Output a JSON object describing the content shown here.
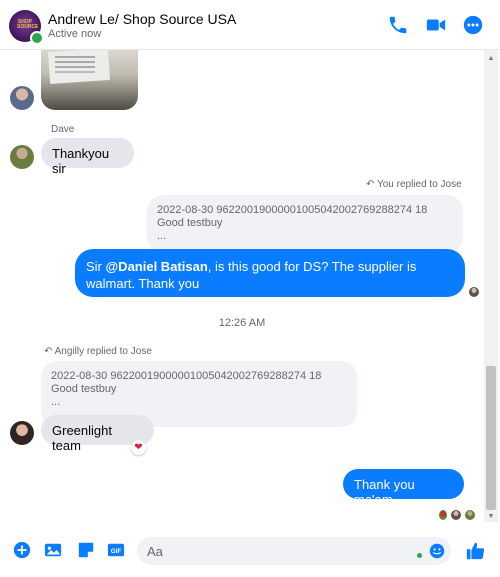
{
  "header": {
    "title": "Andrew Le/ Shop Source USA",
    "status": "Active now",
    "avatar_text": "SHOP SOURCE"
  },
  "messages": {
    "dave_name": "Dave",
    "dave_text": "Thankyou sir",
    "reply1_label": "You replied to Jose",
    "quote1_line1": "2022-08-30     96220019000001005042002769288274 18",
    "quote1_line2": "Good testbuy",
    "quote1_line3": "...",
    "blue1_prefix": "Sir ",
    "blue1_mention": "@Daniel Batisan",
    "blue1_rest": ", is this good for DS? The supplier is walmart. Thank you",
    "time": "12:26 AM",
    "reply2_label": "Angilly replied to Jose",
    "quote2_line1": "2022-08-30     96220019000001005042002769288274 18",
    "quote2_line2": "Good testbuy",
    "quote2_line3": "...",
    "greenlight_text": "Greenlight team",
    "reaction": "❤",
    "blue2_text": "Thank you ma'am"
  },
  "composer": {
    "placeholder": "Aa"
  },
  "colors": {
    "accent": "#0a7cff",
    "online": "#31a24c",
    "bubble_gray": "#e4e6eb"
  },
  "icons": [
    "phone-icon",
    "video-icon",
    "more-icon",
    "plus-circle-icon",
    "photo-icon",
    "sticker-icon",
    "gif-icon",
    "emoji-icon",
    "like-icon",
    "reply-arrow-icon"
  ]
}
